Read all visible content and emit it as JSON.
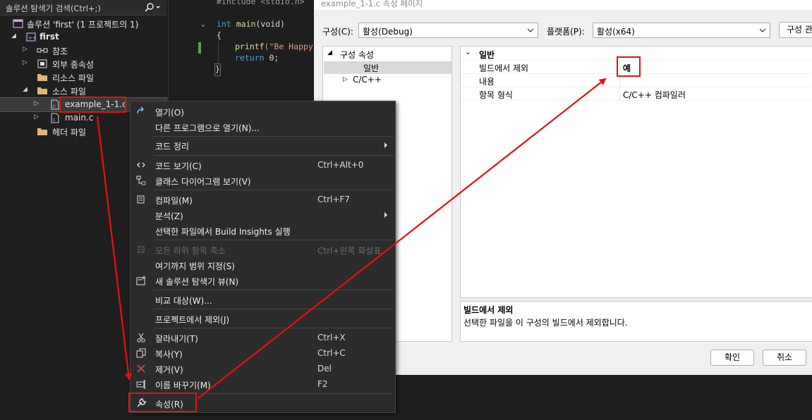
{
  "solution_explorer": {
    "search_placeholder": "솔루션 탐색기 검색(Ctrl+;)",
    "solution": "솔루션 'first' (1 프로젝트의 1)",
    "project": "first",
    "references": "참조",
    "external_deps": "외부 종속성",
    "resource_files": "리소스 파일",
    "source_files": "소스 파일",
    "file_selected": "example_1-1.c",
    "file_main": "main.c",
    "header_files": "헤더 파일"
  },
  "code": {
    "include": "#include <stdio.h>",
    "main_kw": "int",
    "main_fn": "main",
    "main_args": "(void)",
    "brace_open": "{",
    "printf_fn": "printf",
    "printf_str": "(\"Be Happy!",
    "return_kw": "return",
    "return_val": " 0;",
    "brace_close": "}"
  },
  "dialog": {
    "title": "example_1-1.c 속성 페이지",
    "config_label": "구성(C):",
    "config_value": "활성(Debug)",
    "platform_label": "플랫폼(P):",
    "platform_value": "활성(x64)",
    "config_manager": "구성 관",
    "tree_root": "구성 속성",
    "tree_general": "일반",
    "tree_cpp": "C/C++",
    "grid_category": "일반",
    "rows": [
      {
        "key": "빌드에서 제외",
        "value": "예"
      },
      {
        "key": "내용",
        "value": ""
      },
      {
        "key": "항목 형식",
        "value": "C/C++ 컴파일러"
      }
    ],
    "desc_title": "빌드에서 제외",
    "desc_text": "선택한 파일을 이 구성의 빌드에서 제외합니다.",
    "ok": "확인",
    "cancel": "취소"
  },
  "context_menu": {
    "items": [
      {
        "label": "열기(O)",
        "shortcut": ""
      },
      {
        "label": "다른 프로그램으로 열기(N)...",
        "shortcut": ""
      },
      {
        "label": "코드 정리",
        "shortcut": ""
      },
      {
        "label": "코드 보기(C)",
        "shortcut": "Ctrl+Alt+0"
      },
      {
        "label": "클래스 다이어그램 보기(V)",
        "shortcut": ""
      },
      {
        "label": "컴파일(M)",
        "shortcut": "Ctrl+F7"
      },
      {
        "label": "분석(Z)",
        "shortcut": ""
      },
      {
        "label": "선택한 파일에서 Build Insights 실행",
        "shortcut": ""
      },
      {
        "label": "모든 하위 항목 축소",
        "shortcut": "Ctrl+왼쪽 화살표"
      },
      {
        "label": "여기까지 범위 지정(S)",
        "shortcut": ""
      },
      {
        "label": "새 솔루션 탐색기 뷰(N)",
        "shortcut": ""
      },
      {
        "label": "비교 대상(W)...",
        "shortcut": ""
      },
      {
        "label": "프로젝트에서 제외(J)",
        "shortcut": ""
      },
      {
        "label": "잘라내기(T)",
        "shortcut": "Ctrl+X"
      },
      {
        "label": "복사(Y)",
        "shortcut": "Ctrl+C"
      },
      {
        "label": "제거(V)",
        "shortcut": "Del"
      },
      {
        "label": "이름 바꾸기(M)",
        "shortcut": "F2"
      },
      {
        "label": "속성(R)",
        "shortcut": ""
      }
    ]
  },
  "colors": {
    "annotation_red": "#e81010",
    "vs_dark": "#1f1f1f",
    "menu_bg": "#2b2b2b",
    "dialog_bg": "#f0f0f0"
  }
}
